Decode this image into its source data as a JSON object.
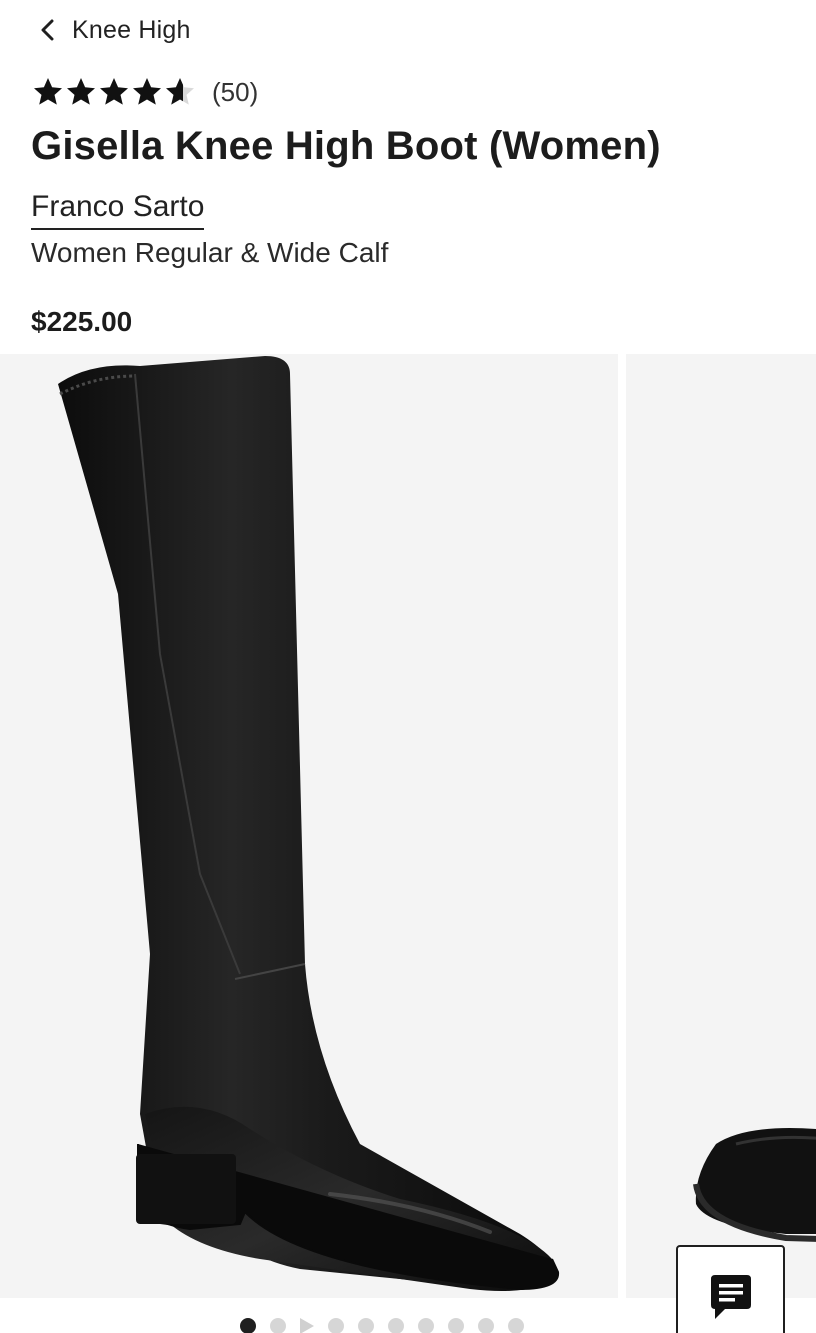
{
  "nav": {
    "back_label": "Knee High"
  },
  "rating": {
    "value": 4.6,
    "max": 5,
    "count_label": "(50)"
  },
  "product": {
    "title": "Gisella Knee High Boot (Women)",
    "brand": "Franco Sarto",
    "subtitle": "Women Regular & Wide Calf",
    "price": "$225.00"
  },
  "gallery": {
    "active_index": 0,
    "total_items": 10,
    "video_index": 2
  },
  "icons": {
    "back": "chevron-left-icon",
    "star": "star-icon",
    "chat": "chat-bubble-icon",
    "video": "play-icon"
  },
  "colors": {
    "text": "#1f1f1f",
    "image_background": "#f4f4f4",
    "dot_active": "#1f1f1f",
    "dot_inactive": "#d6d6d6",
    "star_filled": "#111111",
    "star_empty": "#d9d9d9"
  }
}
